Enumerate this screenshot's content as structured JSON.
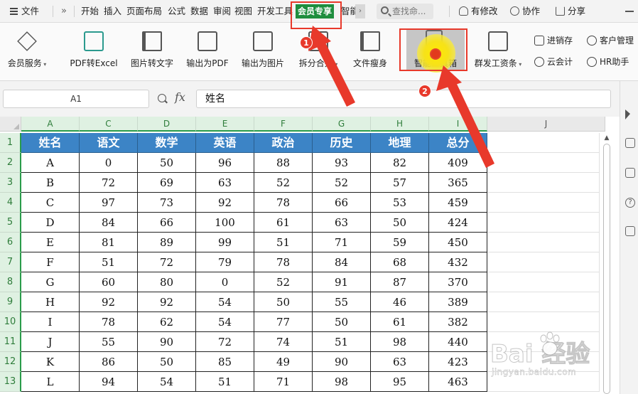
{
  "menubar": {
    "file": "文件",
    "more_tabs": "»",
    "tabs": [
      "开始",
      "插入",
      "页面布局",
      "公式",
      "数据",
      "审阅",
      "视图",
      "开发工具",
      "会员专享",
      "智能"
    ],
    "search_placeholder": "查找命...",
    "actions": [
      "有修改",
      "协作",
      "分享"
    ]
  },
  "ribbon": {
    "buttons": [
      "会员服务",
      "PDF转Excel",
      "图片转文字",
      "输出为PDF",
      "输出为图片",
      "拆分合并",
      "文件瘦身",
      "智能工具箱",
      "群发工资条"
    ],
    "side_tools": [
      "进销存",
      "客户管理",
      "云会计",
      "HR助手"
    ]
  },
  "formula_bar": {
    "name_box": "A1",
    "fx": "fx",
    "content": "姓名"
  },
  "sheet": {
    "columns": [
      "A",
      "C",
      "D",
      "E",
      "F",
      "G",
      "H",
      "I",
      "J"
    ],
    "rows": [
      "1",
      "2",
      "3",
      "4",
      "5",
      "6",
      "7",
      "8",
      "9",
      "10",
      "11",
      "12",
      "13"
    ],
    "headers": [
      "姓名",
      "语文",
      "数学",
      "英语",
      "政治",
      "历史",
      "地理",
      "总分"
    ],
    "data": [
      [
        "A",
        "0",
        "50",
        "96",
        "88",
        "93",
        "82",
        "409"
      ],
      [
        "B",
        "72",
        "69",
        "63",
        "52",
        "52",
        "57",
        "365"
      ],
      [
        "C",
        "97",
        "73",
        "92",
        "78",
        "66",
        "53",
        "459"
      ],
      [
        "D",
        "84",
        "66",
        "100",
        "61",
        "63",
        "50",
        "424"
      ],
      [
        "E",
        "81",
        "89",
        "99",
        "51",
        "71",
        "59",
        "450"
      ],
      [
        "F",
        "51",
        "72",
        "79",
        "78",
        "84",
        "68",
        "432"
      ],
      [
        "G",
        "60",
        "80",
        "0",
        "52",
        "91",
        "87",
        "370"
      ],
      [
        "H",
        "92",
        "92",
        "54",
        "50",
        "55",
        "46",
        "389"
      ],
      [
        "I",
        "78",
        "62",
        "54",
        "77",
        "50",
        "61",
        "382"
      ],
      [
        "J",
        "55",
        "90",
        "72",
        "74",
        "51",
        "98",
        "440"
      ],
      [
        "K",
        "86",
        "50",
        "85",
        "49",
        "90",
        "63",
        "423"
      ],
      [
        "L",
        "94",
        "54",
        "51",
        "71",
        "98",
        "95",
        "463"
      ]
    ]
  },
  "annotations": {
    "step1": "1",
    "step2": "2",
    "color": "#e8392b"
  },
  "watermark": {
    "logo": "Bai  经验",
    "url": "jingyan.baidu.com"
  }
}
